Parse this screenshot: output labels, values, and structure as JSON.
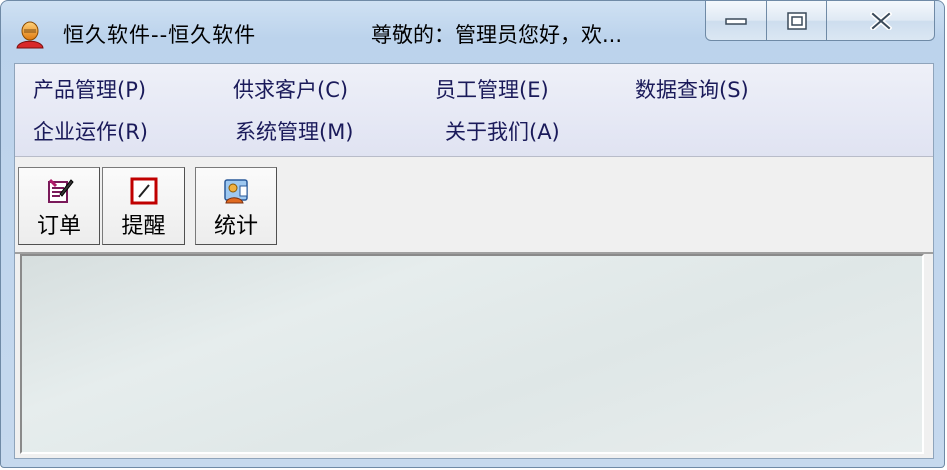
{
  "window": {
    "title": "恒久软件--恒久软件",
    "greeting": "尊敬的：管理员您好，欢..."
  },
  "controls": {
    "minimize_icon": "minimize-icon",
    "maximize_icon": "maximize-icon",
    "close_icon": "close-icon"
  },
  "menu": {
    "items": [
      {
        "label": "产品管理(P)"
      },
      {
        "label": "供求客户(C)"
      },
      {
        "label": "员工管理(E)"
      },
      {
        "label": "数据查询(S)"
      },
      {
        "label": "企业运作(R)"
      },
      {
        "label": "系统管理(M)"
      },
      {
        "label": "关于我们(A)"
      }
    ]
  },
  "toolbar": {
    "buttons": [
      {
        "label": "订单",
        "icon": "order-icon"
      },
      {
        "label": "提醒",
        "icon": "reminder-icon"
      },
      {
        "label": "统计",
        "icon": "statistics-icon"
      }
    ]
  },
  "colors": {
    "titlebar": "#c6d9ee",
    "menubar": "#e4e7f4",
    "menu_text": "#1a1a5a",
    "content": "#e2eaea"
  }
}
